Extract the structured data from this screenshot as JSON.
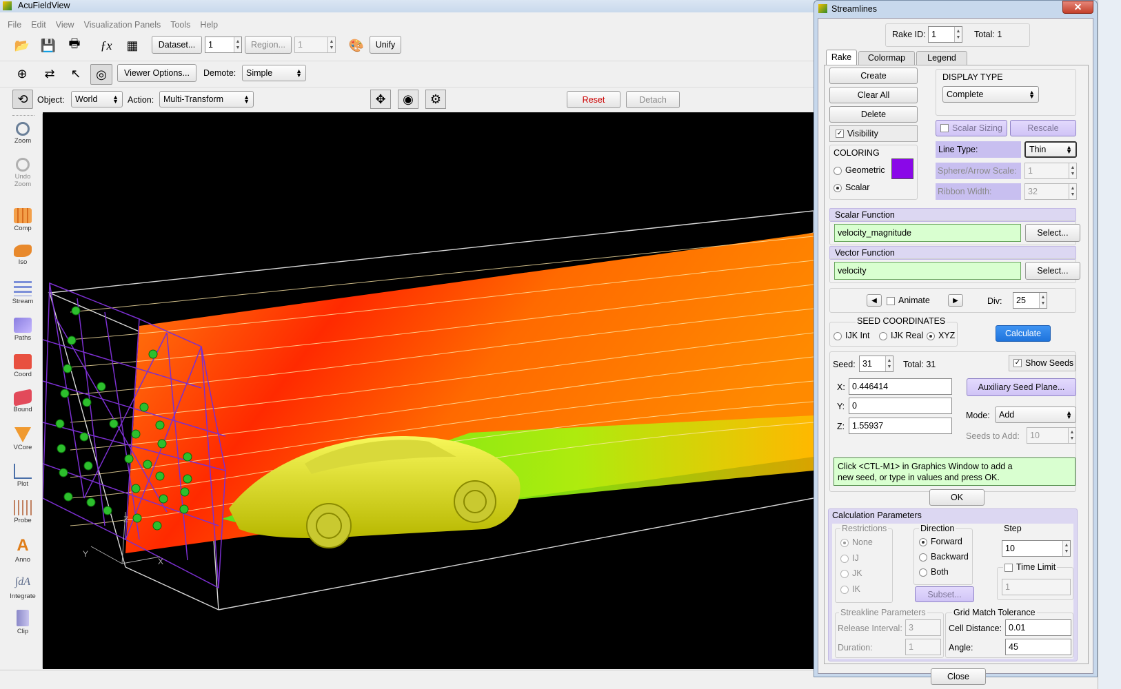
{
  "window": {
    "title": "AcuFieldView"
  },
  "menu": [
    "File",
    "Edit",
    "View",
    "Visualization Panels",
    "Tools",
    "Help"
  ],
  "toolbar1": {
    "dataset_btn": "Dataset...",
    "dataset_val": "1",
    "region_btn": "Region...",
    "region_val": "1",
    "unify": "Unify"
  },
  "toolbar2": {
    "viewer_options": "Viewer Options...",
    "demote_label": "Demote:",
    "demote_val": "Simple"
  },
  "toolbar3": {
    "object_label": "Object:",
    "object_val": "World",
    "action_label": "Action:",
    "action_val": "Multi-Transform",
    "reset": "Reset",
    "detach": "Detach"
  },
  "left_tools": [
    "Zoom",
    "Undo Zoom",
    "Comp",
    "Iso",
    "Stream",
    "Paths",
    "Coord",
    "Bound",
    "VCore",
    "Plot",
    "Probe",
    "Anno",
    "Integrate",
    "Clip"
  ],
  "viewport": {
    "axis_y": "Y",
    "axis_z": "Z",
    "axis_x": "X"
  },
  "dialog": {
    "title": "Streamlines",
    "rake_id_label": "Rake ID:",
    "rake_id": "1",
    "total_label": "Total: 1",
    "tabs": [
      "Rake",
      "Colormap",
      "Legend"
    ],
    "create": "Create",
    "clear_all": "Clear All",
    "delete": "Delete",
    "visibility": "Visibility",
    "display_type_label": "DISPLAY TYPE",
    "display_type": "Complete",
    "scalar_sizing": "Scalar Sizing",
    "rescale": "Rescale",
    "line_type_label": "Line Type:",
    "line_type": "Thin",
    "sphere_scale_label": "Sphere/Arrow Scale:",
    "sphere_scale": "1",
    "ribbon_width_label": "Ribbon Width:",
    "ribbon_width": "32",
    "coloring_label": "COLORING",
    "geometric": "Geometric",
    "scalar": "Scalar",
    "swatch_color": "#8a08e8",
    "scalar_function_label": "Scalar Function",
    "scalar_function": "velocity_magnitude",
    "select": "Select...",
    "vector_function_label": "Vector Function",
    "vector_function": "velocity",
    "animate": "Animate",
    "div_label": "Div:",
    "div": "25",
    "seed_coords_label": "SEED COORDINATES",
    "ijk_int": "IJK Int",
    "ijk_real": "IJK Real",
    "xyz": "XYZ",
    "calculate": "Calculate",
    "seed_label": "Seed:",
    "seed": "31",
    "seed_total": "Total: 31",
    "show_seeds": "Show Seeds",
    "x_label": "X:",
    "x": "0.446414",
    "y_label": "Y:",
    "y": "0",
    "z_label": "Z:",
    "z": "1.55937",
    "aux_seed_plane": "Auxiliary Seed Plane...",
    "mode_label": "Mode:",
    "mode": "Add",
    "seeds_to_add_label": "Seeds to Add:",
    "seeds_to_add": "10",
    "hint_line1": "Click <CTL-M1> in Graphics Window to add a",
    "hint_line2": "new seed, or type in values and press OK.",
    "ok": "OK",
    "calc_params_label": "Calculation Parameters",
    "restrictions_label": "Restrictions",
    "restrictions": [
      "None",
      "IJ",
      "JK",
      "IK"
    ],
    "direction_label": "Direction",
    "directions": [
      "Forward",
      "Backward",
      "Both"
    ],
    "subset": "Subset...",
    "step_label": "Step",
    "step": "10",
    "time_limit": "Time Limit",
    "time_limit_val": "1",
    "streakline_label": "Streakline Parameters",
    "release_interval_label": "Release Interval:",
    "release_interval": "3",
    "duration_label": "Duration:",
    "duration": "1",
    "grid_match_label": "Grid Match Tolerance",
    "cell_distance_label": "Cell Distance:",
    "cell_distance": "0.01",
    "angle_label": "Angle:",
    "angle": "45",
    "close": "Close"
  }
}
